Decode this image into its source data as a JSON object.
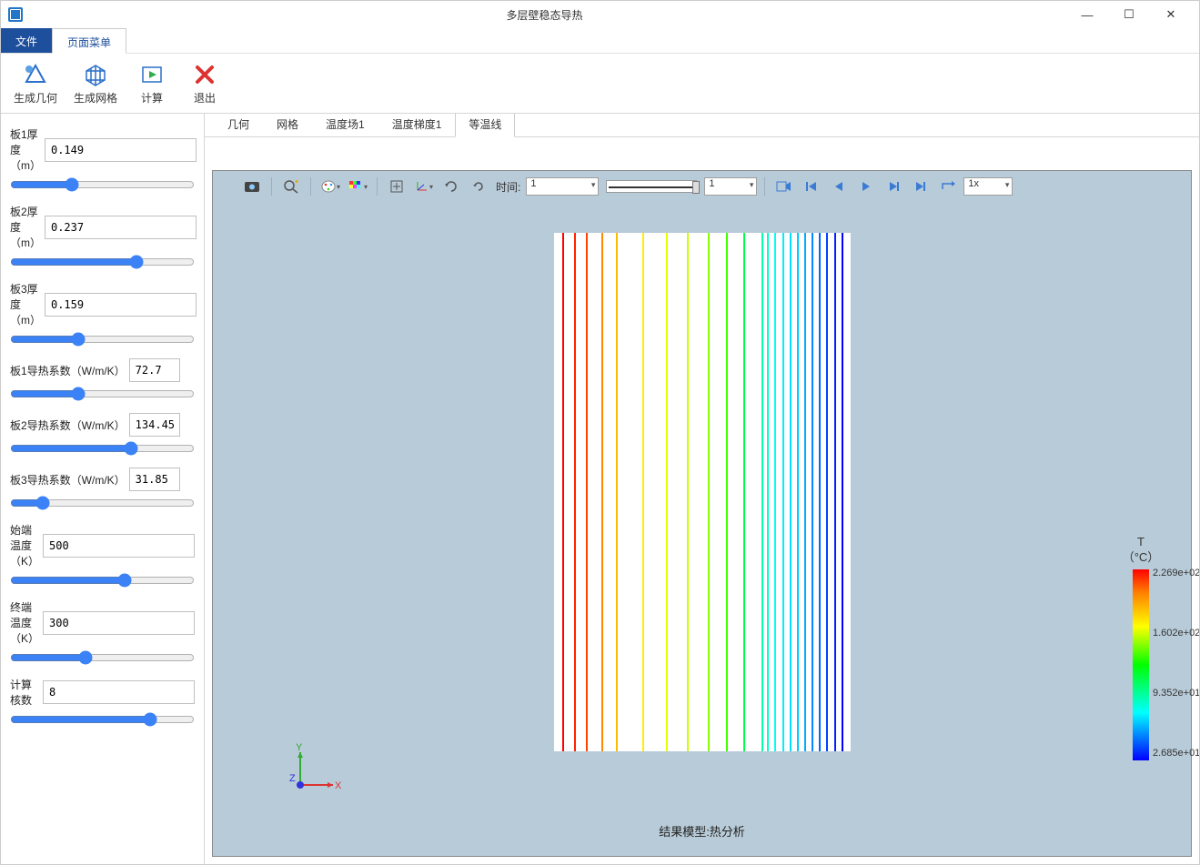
{
  "window": {
    "title": "多层壁稳态导热"
  },
  "menu": {
    "file": "文件",
    "page": "页面菜单"
  },
  "ribbon": {
    "gen_geom": "生成几何",
    "gen_mesh": "生成网格",
    "compute": "计算",
    "exit": "退出"
  },
  "params": {
    "plate1_thickness": {
      "label": "板1厚度（m）",
      "value": "0.149",
      "pct": 32
    },
    "plate2_thickness": {
      "label": "板2厚度（m）",
      "value": "0.237",
      "pct": 70
    },
    "plate3_thickness": {
      "label": "板3厚度（m）",
      "value": "0.159",
      "pct": 36
    },
    "k1": {
      "label": "板1导热系数（W/m/K）",
      "value": "72.7",
      "pct": 36
    },
    "k2": {
      "label": "板2导热系数（W/m/K）",
      "value": "134.45",
      "pct": 67
    },
    "k3": {
      "label": "板3导热系数（W/m/K）",
      "value": "31.85",
      "pct": 15
    },
    "t_start": {
      "label": "始端温度（K）",
      "value": "500",
      "pct": 63
    },
    "t_end": {
      "label": "终端温度（K）",
      "value": "300",
      "pct": 40
    },
    "cores": {
      "label": "计算核数",
      "value": "8",
      "pct": 78
    }
  },
  "tabs": {
    "items": [
      "几何",
      "网格",
      "温度场1",
      "温度梯度1",
      "等温线"
    ],
    "active_index": 4
  },
  "toolbar": {
    "time_label": "时间:",
    "time_value": "1",
    "frame_value": "1",
    "speed": "1x"
  },
  "plot": {
    "title": "结果模型:热分析"
  },
  "legend": {
    "title1": "T",
    "title2": "（°C）",
    "ticks": [
      "2.269e+02",
      "1.602e+02",
      "9.352e+01",
      "2.685e+01"
    ]
  },
  "axes": {
    "x": "X",
    "y": "Y",
    "z": "Z"
  },
  "chart_data": {
    "type": "heatmap",
    "title": "结果模型:热分析 — 等温线",
    "colormap": "rainbow",
    "scalar_name": "T",
    "scalar_unit": "°C",
    "scalar_range": [
      26.85,
      226.9
    ],
    "legend_ticks": [
      226.9,
      160.2,
      93.52,
      26.85
    ],
    "isolines": [
      {
        "x_norm": 0.03,
        "color": "#ff0000"
      },
      {
        "x_norm": 0.07,
        "color": "#ff2200"
      },
      {
        "x_norm": 0.11,
        "color": "#ff4400"
      },
      {
        "x_norm": 0.16,
        "color": "#ff8800"
      },
      {
        "x_norm": 0.21,
        "color": "#ffbb00"
      },
      {
        "x_norm": 0.3,
        "color": "#ffee00"
      },
      {
        "x_norm": 0.38,
        "color": "#e8ff00"
      },
      {
        "x_norm": 0.45,
        "color": "#ccff00"
      },
      {
        "x_norm": 0.52,
        "color": "#88ff00"
      },
      {
        "x_norm": 0.58,
        "color": "#44ff00"
      },
      {
        "x_norm": 0.64,
        "color": "#00ff44"
      },
      {
        "x_norm": 0.7,
        "color": "#00ffaa"
      },
      {
        "x_norm": 0.72,
        "color": "#00ffcc"
      },
      {
        "x_norm": 0.745,
        "color": "#00ffee"
      },
      {
        "x_norm": 0.77,
        "color": "#00eeff"
      },
      {
        "x_norm": 0.795,
        "color": "#00ddff"
      },
      {
        "x_norm": 0.82,
        "color": "#00ccff"
      },
      {
        "x_norm": 0.845,
        "color": "#00aaff"
      },
      {
        "x_norm": 0.87,
        "color": "#0088ff"
      },
      {
        "x_norm": 0.895,
        "color": "#0066ff"
      },
      {
        "x_norm": 0.92,
        "color": "#0044ff"
      },
      {
        "x_norm": 0.945,
        "color": "#0022ff"
      },
      {
        "x_norm": 0.97,
        "color": "#0000ff"
      }
    ]
  }
}
